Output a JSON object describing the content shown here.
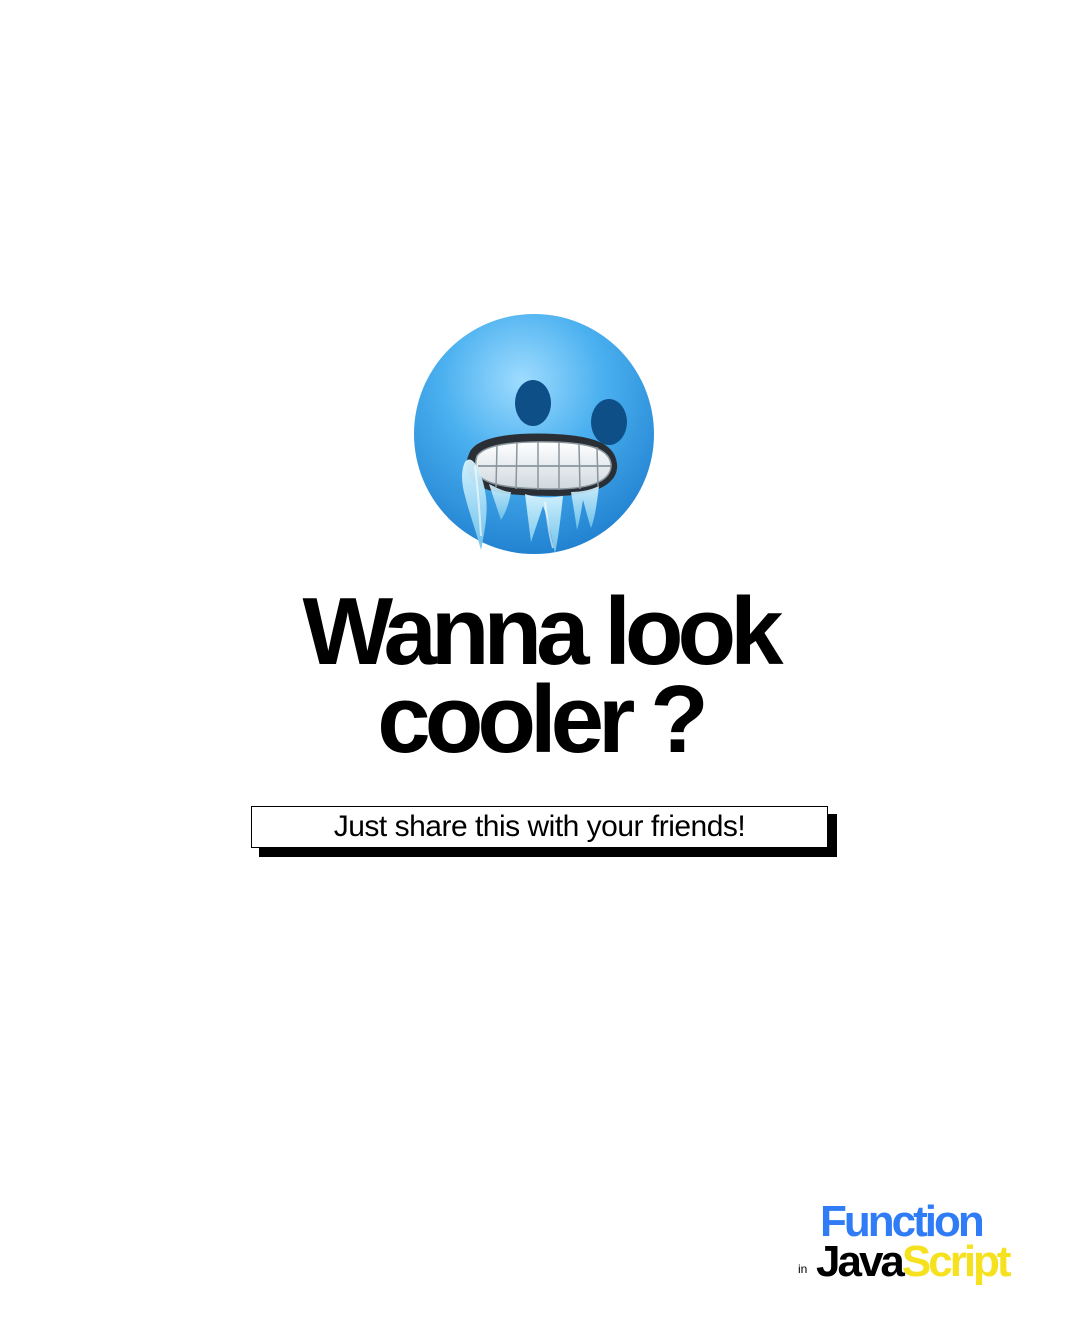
{
  "emoji": {
    "icon": "cold-face-icon"
  },
  "headline": {
    "line1": "Wanna look",
    "line2": "cooler ?"
  },
  "cta": {
    "text": "Just share this with your friends!"
  },
  "brand": {
    "word1": "Function",
    "in": "in",
    "word2a": "Java",
    "word2b": "Script",
    "colors": {
      "function": "#2f7cf6",
      "java": "#000000",
      "script": "#f5e11d"
    }
  }
}
